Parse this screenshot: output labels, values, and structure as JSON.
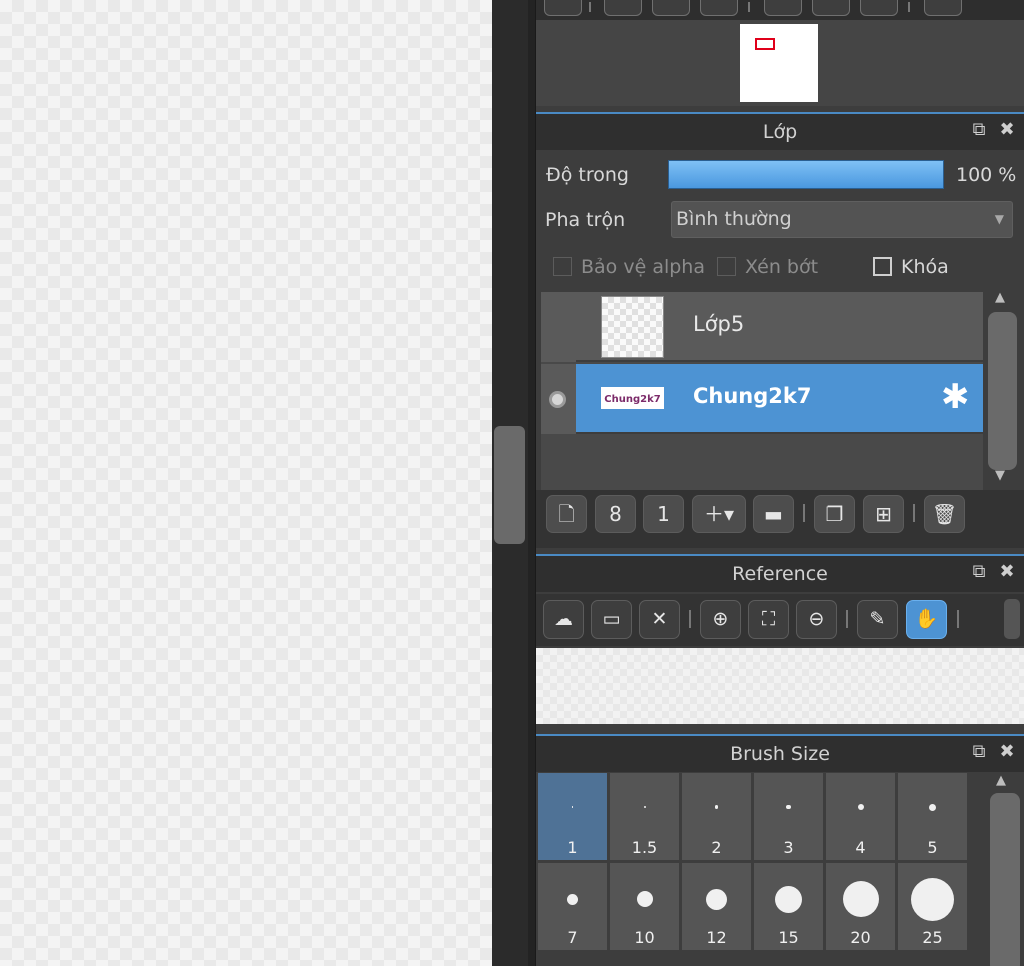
{
  "layer_panel": {
    "title": "Lớp",
    "opacity_label": "Độ trong",
    "opacity_value": "100 %",
    "opacity_fraction": 1.0,
    "blend_label": "Pha trộn",
    "blend_value": "Bình thường",
    "protect_alpha_label": "Bảo vệ alpha",
    "clipping_label": "Xén bớt",
    "lock_label": "Khóa",
    "layers": [
      {
        "name": "Lớp5",
        "selected": false
      },
      {
        "name": "Chung2k7",
        "selected": true,
        "thumb_text": "Chung2k7"
      }
    ]
  },
  "reference_panel": {
    "title": "Reference"
  },
  "brush_panel": {
    "title": "Brush Size",
    "sizes": [
      "1",
      "1.5",
      "2",
      "3",
      "4",
      "5",
      "7",
      "10",
      "12",
      "15",
      "20",
      "25"
    ],
    "selected": "1"
  },
  "colors": {
    "accent": "#4d93d3",
    "panel_bg": "#3d3d3d",
    "header_bg": "#2f2f2f"
  }
}
